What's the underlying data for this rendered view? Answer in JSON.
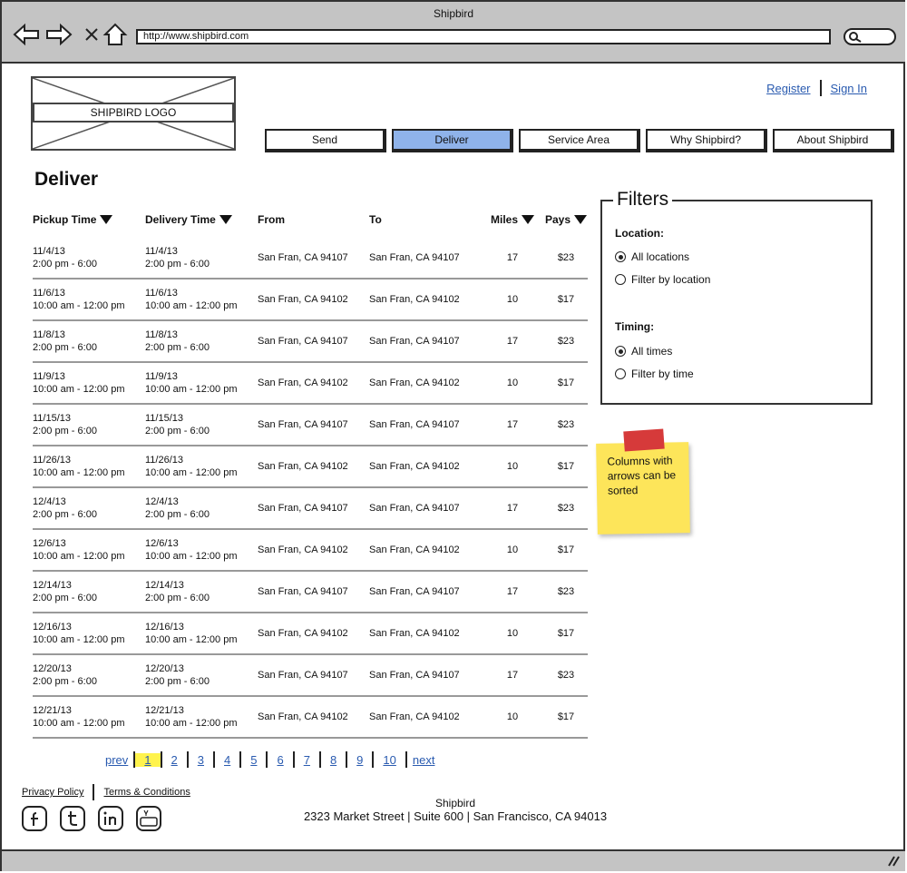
{
  "window": {
    "title": "Shipbird",
    "url": "http://www.shipbird.com"
  },
  "logo": {
    "label": "SHIPBIRD LOGO"
  },
  "toplinks": {
    "register": "Register",
    "signin": "Sign In"
  },
  "tabs": [
    {
      "label": "Send",
      "active": false
    },
    {
      "label": "Deliver",
      "active": true
    },
    {
      "label": "Service Area",
      "active": false
    },
    {
      "label": "Why Shipbird?",
      "active": false
    },
    {
      "label": "About Shipbird",
      "active": false
    }
  ],
  "page_title": "Deliver",
  "table": {
    "headers": [
      "Pickup Time",
      "Delivery Time",
      "From",
      "To",
      "Miles",
      "Pays"
    ],
    "rows": [
      {
        "pickup_date": "11/4/13",
        "pickup_time": "2:00 pm - 6:00",
        "delivery_date": "11/4/13",
        "delivery_time": "2:00 pm - 6:00",
        "from": "San Fran, CA 94107",
        "to": "San Fran, CA 94107",
        "miles": "17",
        "pays": "$23"
      },
      {
        "pickup_date": "11/6/13",
        "pickup_time": "10:00 am - 12:00 pm",
        "delivery_date": "11/6/13",
        "delivery_time": "10:00 am - 12:00 pm",
        "from": "San Fran, CA 94102",
        "to": "San Fran, CA 94102",
        "miles": "10",
        "pays": "$17"
      },
      {
        "pickup_date": "11/8/13",
        "pickup_time": "2:00 pm - 6:00",
        "delivery_date": "11/8/13",
        "delivery_time": "2:00 pm - 6:00",
        "from": "San Fran, CA 94107",
        "to": "San Fran, CA 94107",
        "miles": "17",
        "pays": "$23"
      },
      {
        "pickup_date": "11/9/13",
        "pickup_time": "10:00 am - 12:00 pm",
        "delivery_date": "11/9/13",
        "delivery_time": "10:00 am - 12:00 pm",
        "from": "San Fran, CA 94102",
        "to": "San Fran, CA 94102",
        "miles": "10",
        "pays": "$17"
      },
      {
        "pickup_date": "11/15/13",
        "pickup_time": "2:00 pm - 6:00",
        "delivery_date": "11/15/13",
        "delivery_time": "2:00 pm - 6:00",
        "from": "San Fran, CA 94107",
        "to": "San Fran, CA 94107",
        "miles": "17",
        "pays": "$23"
      },
      {
        "pickup_date": "11/26/13",
        "pickup_time": "10:00 am - 12:00 pm",
        "delivery_date": "11/26/13",
        "delivery_time": "10:00 am - 12:00 pm",
        "from": "San Fran, CA 94102",
        "to": "San Fran, CA 94102",
        "miles": "10",
        "pays": "$17"
      },
      {
        "pickup_date": "12/4/13",
        "pickup_time": "2:00 pm - 6:00",
        "delivery_date": "12/4/13",
        "delivery_time": "2:00 pm - 6:00",
        "from": "San Fran, CA 94107",
        "to": "San Fran, CA 94107",
        "miles": "17",
        "pays": "$23"
      },
      {
        "pickup_date": "12/6/13",
        "pickup_time": "10:00 am - 12:00 pm",
        "delivery_date": "12/6/13",
        "delivery_time": "10:00 am - 12:00 pm",
        "from": "San Fran, CA 94102",
        "to": "San Fran, CA 94102",
        "miles": "10",
        "pays": "$17"
      },
      {
        "pickup_date": "12/14/13",
        "pickup_time": "2:00 pm - 6:00",
        "delivery_date": "12/14/13",
        "delivery_time": "2:00 pm - 6:00",
        "from": "San Fran, CA 94107",
        "to": "San Fran, CA 94107",
        "miles": "17",
        "pays": "$23"
      },
      {
        "pickup_date": "12/16/13",
        "pickup_time": "10:00 am - 12:00 pm",
        "delivery_date": "12/16/13",
        "delivery_time": "10:00 am - 12:00 pm",
        "from": "San Fran, CA 94102",
        "to": "San Fran, CA 94102",
        "miles": "10",
        "pays": "$17"
      },
      {
        "pickup_date": "12/20/13",
        "pickup_time": "2:00 pm - 6:00",
        "delivery_date": "12/20/13",
        "delivery_time": "2:00 pm - 6:00",
        "from": "San Fran, CA 94107",
        "to": "San Fran, CA 94107",
        "miles": "17",
        "pays": "$23"
      },
      {
        "pickup_date": "12/21/13",
        "pickup_time": "10:00 am - 12:00 pm",
        "delivery_date": "12/21/13",
        "delivery_time": "10:00 am - 12:00 pm",
        "from": "San Fran, CA 94102",
        "to": "San Fran, CA 94102",
        "miles": "10",
        "pays": "$17"
      }
    ]
  },
  "pagination": {
    "prev": "prev",
    "next": "next",
    "pages": [
      "1",
      "2",
      "3",
      "4",
      "5",
      "6",
      "7",
      "8",
      "9",
      "10"
    ],
    "current": "1"
  },
  "filters": {
    "title": "Filters",
    "location_label": "Location:",
    "location_all": "All locations",
    "location_filter": "Filter by location",
    "timing_label": "Timing:",
    "timing_all": "All times",
    "timing_filter": "Filter by time"
  },
  "note": {
    "text": "Columns with arrows can be sorted"
  },
  "footer": {
    "privacy": "Privacy Policy",
    "terms": "Terms & Conditions",
    "company": "Shipbird",
    "address": "2323 Market Street  | Suite 600  | San Francisco, CA 94013",
    "social_icons": [
      "facebook-icon",
      "twitter-icon",
      "linkedin-icon",
      "youtube-icon"
    ]
  },
  "colors": {
    "active_tab": "#8fb3ea",
    "link": "#2a5bb0",
    "note": "#fde55a",
    "current_page": "#fff34d"
  }
}
